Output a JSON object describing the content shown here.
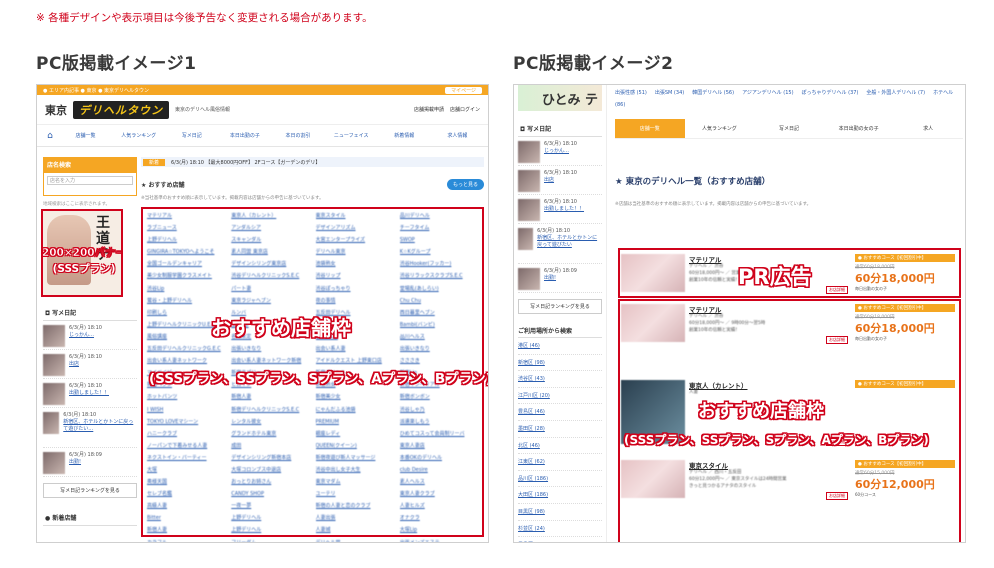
{
  "notice": "※ 各種デザインや表示項目は今後予告なく変更される場合があります。",
  "left": {
    "title": "PC版掲載イメージ1",
    "topbar": {
      "left": "● エリア内記事 ● 東京 ● 東京デリヘルタウン",
      "right": "マイページ"
    },
    "header": {
      "region": "東京",
      "logo": "デリヘルタウン",
      "desc": "東京のデリヘル風俗情報",
      "links": [
        "店舗掲載申請",
        "店舗ログイン"
      ]
    },
    "gnav": [
      "店舗一覧",
      "人気ランキング",
      "写メ日記",
      "本日出勤の子",
      "本日の割引",
      "ニューフェイス",
      "新着情報",
      "求人情報"
    ],
    "search": {
      "head": "店名検索",
      "placeholder": "店名を入力",
      "note": "地域検索はここに表示されます。"
    },
    "banner": {
      "label1": "200×200バナー",
      "label2": "(SSSプラン)",
      "shop": "王道マッサージ ひとみ"
    },
    "diary_head": "写メ日記",
    "diaries": [
      {
        "date": "6/3(月) 18:10",
        "text": "じっかん…"
      },
      {
        "date": "6/3(月) 18:10",
        "text": "出店"
      },
      {
        "date": "6/3(月) 18:10",
        "text": "出勤しました！！"
      },
      {
        "date": "6/3(月) 18:10",
        "text": "新宿区、ホテルとかトンに戻って遊びたい…"
      },
      {
        "date": "6/3(月) 18:09",
        "text": "出勤!"
      }
    ],
    "more_diary": "写メ日記ランキングを見る",
    "new_head": "新着店舗",
    "info_bar": {
      "tag": "新着",
      "text": "6/3(月) 18:10 【最大8000円OFF】 2Fコース【ガーデンのデリ】"
    },
    "rec_head": "おすすめ店舗",
    "rec_btn": "もっと見る",
    "rec_note": "※当社基準のおすすめ順に表示しています。掲載内容は店舗からの申告に基づいています。",
    "shops": [
      "マテリアル",
      "東京人（カレント）",
      "東京スタイル",
      "品川デリヘル",
      "ラブニュース",
      "アンダルシア",
      "デザインアリズム",
      "チーフタイム",
      "上野デリヘル",
      "スキャンダル",
      "大宮エンタープライズ",
      "SWOP",
      "GINGIRA☆TOKYOへようこそ",
      "素人同盟 東京店",
      "デリヘル東京",
      "K☆Kグループ",
      "全国ゴールデンキャリア",
      "デザインシリング東京店",
      "池袋熟女",
      "渋谷Hooker(フッカー)",
      "美少女制服学園クラスメイト",
      "渋谷デリヘルクリニックS.E.C",
      "渋谷リップ",
      "渋谷リラックスクラブS.E.C",
      "渋谷Lip",
      "パート妻",
      "渋谷ぽっちゃり",
      "堂場乱(あしらい)",
      "鶯谷・上野デリヘル",
      "東京ラジャヘブン",
      "夜の事情",
      "Chu Chu",
      "印刷しら",
      "ルンバ",
      "五反田デリヘル",
      "西日暮里ヘブン",
      "上野デリヘルクリニックU.E.C",
      "上野Lip",
      "添い寝屋さん",
      "Bambi(バンビ)",
      "風俗講座",
      "名前未定",
      "五反田Lip",
      "品川ヘルス",
      "五反田デリヘルクリニックG.E.C",
      "出張いきなり",
      "出会い系人妻",
      "出張いきなり",
      "出会い系人妻ネットワーク",
      "出会い系人妻ネットワーク新宿",
      "アイドルクエスト 上野東口店",
      "さささき",
      "マイベイビー",
      "新宿ラブリー",
      "新宿デリヘル",
      "新宿Lip",
      "新宿ヘブン",
      "ヒロイン",
      "新宿熟女",
      "新宿インペリアル",
      "ホットパンツ",
      "新宿人妻",
      "新宿美少女",
      "新宿ボンボン",
      "I WISH",
      "新宿デリヘルクリニックS.E.C",
      "にゃんだふる池袋",
      "渋谷しゃ乃",
      "TOKYO LOVEマシーン",
      "レンタル彼女",
      "PREMIUM",
      "派遣楽しもう",
      "ハニークラブ",
      "グランドホテル東京",
      "銀座レディ",
      "ひめてコスって会員制リーバ",
      "ノーパンで下着みせる人妻",
      "成田",
      "QUEEN(クイーン)",
      "東京人妻店",
      "ネクストイン・パーティー",
      "デザインシリング新宿本店",
      "新宿夜遊び新人マッサージ",
      "本番OKのデリヘル",
      "大塚",
      "大塚コロンブス中退店",
      "渋谷中出し女子大生",
      "club Desire",
      "奥様天国",
      "おっとりお姉さん",
      "東京マダム",
      "素人ヘルス",
      "セレブ名鑑",
      "CANDY SHOP",
      "ユーテリ",
      "東京人妻クラブ",
      "高級人妻",
      "一夜一夢",
      "新宿の人妻と恋のクラブ",
      "人妻ヒルズ",
      "Bitter",
      "上野デリヘル",
      "人妻出張",
      "オナクラ",
      "新宿人妻",
      "上野デリヘル",
      "人妻城",
      "大塚Lip",
      "カラフル",
      "フリーダム",
      "デリヘル堂",
      "出張メンズエステ"
    ],
    "overlay": {
      "top": "おすすめ店舗枠",
      "bottom": "(SSSプラン、SSプラン、Sプラン、Aプラン、Bプラン)"
    }
  },
  "right": {
    "title": "PC版掲載イメージ2",
    "logo": "ひとみ テ",
    "diary_head": "写メ日記",
    "diaries": [
      {
        "date": "6/3(月) 18:10",
        "text": "じっかん…"
      },
      {
        "date": "6/3(月) 18:10",
        "text": "出店"
      },
      {
        "date": "6/3(月) 18:10",
        "text": "出勤しました！！"
      },
      {
        "date": "6/3(月) 18:10",
        "text": "新宿区、ホテルとかトンに戻って遊びたい"
      },
      {
        "date": "6/3(月) 18:09",
        "text": "出勤!"
      }
    ],
    "more_diary": "写メ日記ランキングを見る",
    "area_head": "ご利用場所から検索",
    "areas": [
      "港区 (46)",
      "新宿区 (98)",
      "渋谷区 (43)",
      "江戸川区 (20)",
      "豊島区 (46)",
      "墨田区 (28)",
      "北区 (46)",
      "江東区 (62)",
      "品川区 (186)",
      "大田区 (186)",
      "目黒区 (98)",
      "杉並区 (24)",
      "豊島区 (89)"
    ],
    "links": [
      "出張性感 (51)",
      "出張SM (34)",
      "韓国デリヘル (56)",
      "アジアンデリヘル (15)",
      "ぽっちゃりデリヘル (37)",
      "全般・外国人デリヘル (7)",
      "ホテヘル (86)"
    ],
    "tabs": [
      "店舗一覧",
      "人気ランキング",
      "写メ日記",
      "本日出勤の女の子",
      "求人"
    ],
    "list_title": "東京のデリヘル一覧（おすすめ店舗）",
    "list_note": "※店舗は当社基準のおすすめ順に表示しています。掲載内容は店舗からの申告に基づいています。",
    "cards": [
      {
        "name": "マテリアル",
        "area": "デリヘル ／ 渋谷",
        "line": "60分18,000円〜 ／ 営業時間:9時〜翌5時",
        "desc": "創業10年の信頼と実績！",
        "tag": "● おすすめコース【初回割引中】",
        "old": "通常60分18,000円",
        "new": "60分18,000円",
        "pn": "毎日出勤の女の子",
        "btn": "お店詳細",
        "overlay": "PR広告"
      },
      {
        "name": "マテリアル",
        "area": "デリヘル ／ 渋谷",
        "line": "60分18,000円〜 ／ 9時00分〜翌5時",
        "desc": "創業10年の信頼と実績！",
        "tag": "● おすすめコース【初回割引中】",
        "old": "通常60分18,000円",
        "new": "60分18,000円",
        "pn": "毎日出勤の女の子",
        "btn": "お店詳細"
      },
      {
        "name": "東京人（カレント）",
        "area": "人妻",
        "line": "",
        "desc": "",
        "tag": "● おすすめコース【初回割引中】",
        "old": "",
        "new": "",
        "pn": "",
        "btn": "お店詳細"
      },
      {
        "name": "東京スタイル",
        "area": "デリヘル ／ 西川・五反田",
        "line": "60分12,000円〜 ／ 東京スタイルは24時間営業",
        "desc": "きっと見つかるアナタのスタイル",
        "tag": "● おすすめコース【初回割引中】",
        "old": "通常60分15,000円",
        "new": "60分12,000円",
        "pn": "60分コース",
        "btn": "お店詳細"
      }
    ],
    "overlay": {
      "mid": "おすすめ店舗枠",
      "bottom": "(SSSプラン、SSプラン、Sプラン、Aプラン、Bプラン)"
    }
  }
}
